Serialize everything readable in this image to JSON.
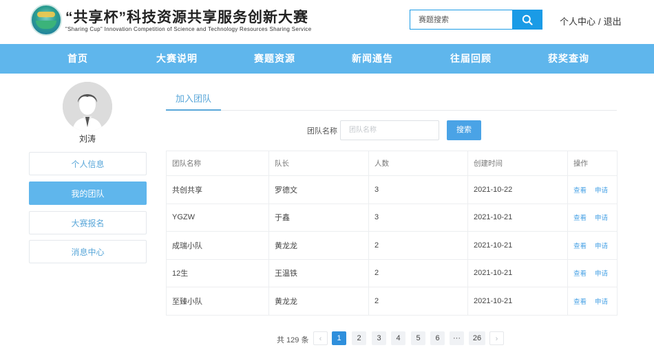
{
  "header": {
    "title": "“共享杯”科技资源共享服务创新大赛",
    "subtitle": "\"Sharing Cup\"  Innovation Competition of Science and Technology Resources Sharing Service",
    "search_placeholder": "赛题搜索",
    "user_center": "个人中心",
    "separator": "/",
    "logout": "退出"
  },
  "nav": [
    "首页",
    "大赛说明",
    "赛题资源",
    "新闻通告",
    "往届回顾",
    "获奖查询"
  ],
  "sidebar": {
    "username": "刘涛",
    "menu": [
      "个人信息",
      "我的团队",
      "大赛报名",
      "消息中心"
    ],
    "active_index": 1
  },
  "main": {
    "tab": "加入团队",
    "filter_label": "团队名称",
    "filter_placeholder": "团队名称",
    "search_button": "搜索",
    "columns": [
      "团队名称",
      "队长",
      "人数",
      "创建时间",
      "操作"
    ],
    "rows": [
      {
        "name": "共创共享",
        "leader": "罗德文",
        "count": "3",
        "date": "2021-10-22"
      },
      {
        "name": "YGZW",
        "leader": "于鑫",
        "count": "3",
        "date": "2021-10-21"
      },
      {
        "name": "成瑞小队",
        "leader": "黄龙龙",
        "count": "2",
        "date": "2021-10-21"
      },
      {
        "name": "12生",
        "leader": "王温铁",
        "count": "2",
        "date": "2021-10-21"
      },
      {
        "name": "至臻小队",
        "leader": "黄龙龙",
        "count": "2",
        "date": "2021-10-21"
      }
    ],
    "actions": {
      "view": "查看",
      "apply": "申请"
    }
  },
  "pagination": {
    "total": "共 129 条",
    "prev": "‹",
    "next": "›",
    "pages": [
      "1",
      "2",
      "3",
      "4",
      "5",
      "6",
      "···",
      "26"
    ],
    "current": "1"
  },
  "colors": {
    "accent": "#5fb6ec",
    "primary": "#1a9be6",
    "link": "#4aa3e6"
  }
}
